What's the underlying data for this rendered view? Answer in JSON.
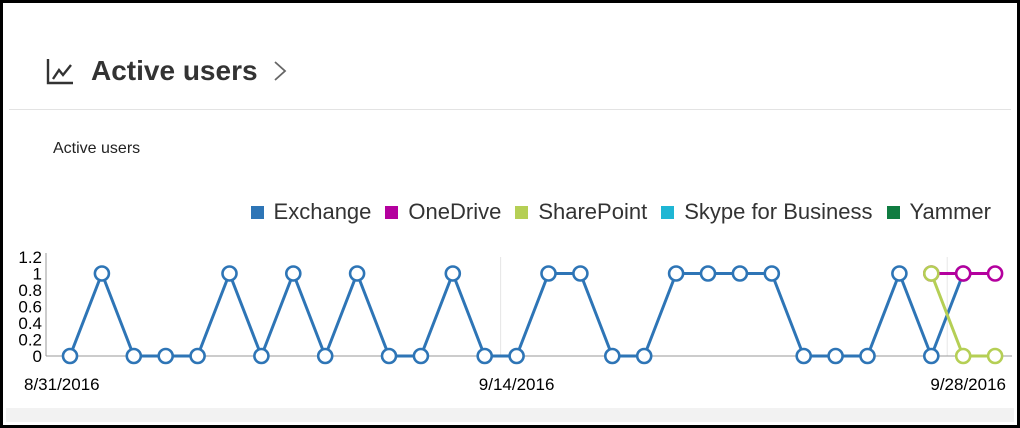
{
  "card": {
    "title": "Active users",
    "icon": "line-chart-icon",
    "chevron_icon": "chevron-right-icon"
  },
  "chart_data": {
    "type": "line",
    "title": "Active users",
    "xlabel": "",
    "ylabel": "",
    "ylim": [
      0,
      1.2
    ],
    "y_ticks": [
      "0",
      "0.2",
      "0.4",
      "0.6",
      "0.8",
      "1",
      "1.2"
    ],
    "x_tick_labels": [
      "8/31/2016",
      "9/14/2016",
      "9/28/2016"
    ],
    "grid": "vertical",
    "legend_position": "top-right",
    "x": [
      "8/31/2016",
      "9/1/2016",
      "9/2/2016",
      "9/3/2016",
      "9/4/2016",
      "9/5/2016",
      "9/6/2016",
      "9/7/2016",
      "9/8/2016",
      "9/9/2016",
      "9/10/2016",
      "9/11/2016",
      "9/12/2016",
      "9/13/2016",
      "9/14/2016",
      "9/15/2016",
      "9/16/2016",
      "9/17/2016",
      "9/18/2016",
      "9/19/2016",
      "9/20/2016",
      "9/21/2016",
      "9/22/2016",
      "9/23/2016",
      "9/24/2016",
      "9/25/2016",
      "9/26/2016",
      "9/27/2016",
      "9/28/2016",
      "9/29/2016"
    ],
    "series": [
      {
        "name": "Exchange",
        "color": "#2e75b6",
        "values": [
          0,
          1,
          0,
          0,
          0,
          1,
          0,
          1,
          0,
          1,
          0,
          0,
          1,
          0,
          0,
          1,
          1,
          0,
          0,
          1,
          1,
          1,
          1,
          0,
          0,
          0,
          1,
          0,
          1,
          null
        ]
      },
      {
        "name": "OneDrive",
        "color": "#b4009e",
        "values": [
          null,
          null,
          null,
          null,
          null,
          null,
          null,
          null,
          null,
          null,
          null,
          null,
          null,
          null,
          null,
          null,
          null,
          null,
          null,
          null,
          null,
          null,
          null,
          null,
          null,
          null,
          null,
          1,
          1,
          1
        ]
      },
      {
        "name": "SharePoint",
        "color": "#b5cf55",
        "values": [
          null,
          null,
          null,
          null,
          null,
          null,
          null,
          null,
          null,
          null,
          null,
          null,
          null,
          null,
          null,
          null,
          null,
          null,
          null,
          null,
          null,
          null,
          null,
          null,
          null,
          null,
          null,
          1,
          0,
          0
        ]
      },
      {
        "name": "Skype for Business",
        "color": "#1fb6d4",
        "values": []
      },
      {
        "name": "Yammer",
        "color": "#107c41",
        "values": []
      }
    ]
  }
}
